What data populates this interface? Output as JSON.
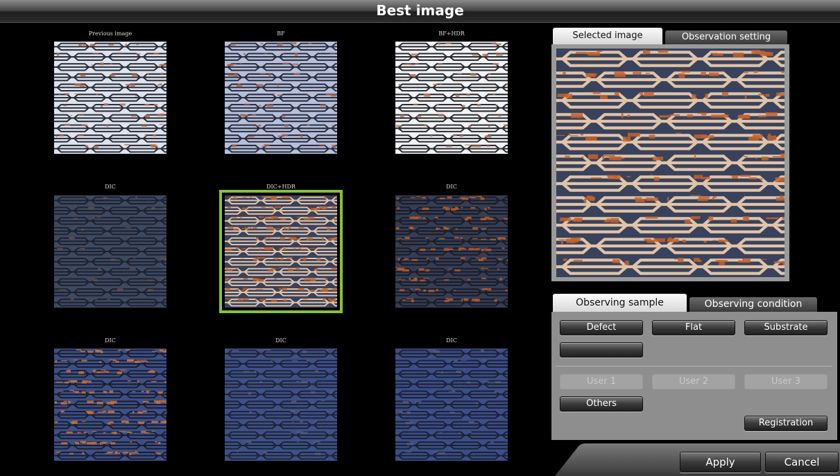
{
  "window": {
    "title": "Best image"
  },
  "thumbnails": [
    {
      "label": "Previous image",
      "style": "bf"
    },
    {
      "label": "BF",
      "style": "bf-blue"
    },
    {
      "label": "BF+HDR",
      "style": "bf-bright"
    },
    {
      "label": "DIC",
      "style": "dic-dark"
    },
    {
      "label": "DIC+HDR",
      "style": "dic-hdr",
      "selected": true
    },
    {
      "label": "DIC",
      "style": "dic-copper"
    },
    {
      "label": "DIC",
      "style": "dic-blue-copper"
    },
    {
      "label": "DIC",
      "style": "dic-blue"
    },
    {
      "label": "DIC",
      "style": "dic-blue2"
    }
  ],
  "preview_tabs": {
    "selected_image": "Selected image",
    "observation_setting": "Observation setting"
  },
  "sample_tabs": {
    "observing_sample": "Observing sample",
    "observing_condition": "Observing condition"
  },
  "sample_buttons": {
    "defect": "Defect",
    "flat": "Flat",
    "substrate": "Substrate",
    "blank": "",
    "user1": "User 1",
    "user2": "User 2",
    "user3": "User 3",
    "others": "Others",
    "registration": "Registration"
  },
  "footer": {
    "apply": "Apply",
    "cancel": "Cancel"
  },
  "colors": {
    "selection_outline": "#88c136",
    "panel_bg": "#8e8e8e"
  }
}
